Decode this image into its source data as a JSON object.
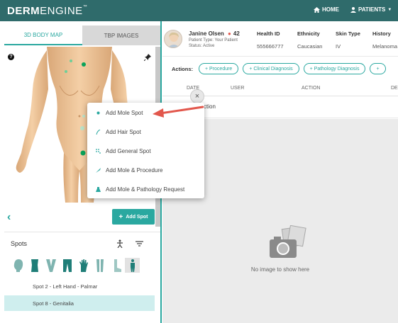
{
  "app": {
    "logo_bold": "DERM",
    "logo_light": "ENGINE",
    "logo_tm": "™",
    "nav_home": "HOME",
    "nav_patients": "PATIENTS"
  },
  "left": {
    "tabs": [
      {
        "label": "3D BODY MAP",
        "active": true
      },
      {
        "label": "TBP IMAGES",
        "active": false
      }
    ],
    "help_icon": "?",
    "add_spot_label": "Add Spot",
    "back_icon": "‹"
  },
  "spots": {
    "title": "Spots",
    "body_parts": [
      "head",
      "torso",
      "neck",
      "legs",
      "hand",
      "legs-back",
      "foot",
      "full-body"
    ],
    "items": [
      {
        "label": "Spot 2 - Left Hand - Palmar",
        "selected": false
      },
      {
        "label": "Spot 8 - Genitalia",
        "selected": true
      }
    ]
  },
  "patient": {
    "name": "Janine Olsen",
    "age": "42",
    "type": "Patient Type: Your Patient",
    "status": "Status: Active",
    "health_id_label": "Health ID",
    "health_id": "555666777",
    "ethnicity_label": "Ethnicity",
    "ethnicity": "Caucasian",
    "skin_type_label": "Skin Type",
    "skin_type": "IV",
    "history_label": "History",
    "history": "Melanoma"
  },
  "actions": {
    "label": "Actions:",
    "buttons": [
      "+ Procedure",
      "+ Clinical Diagnosis",
      "+ Pathology Diagnosis",
      "+"
    ]
  },
  "table": {
    "headers": [
      "DATE",
      "USER",
      "ACTION",
      "DE"
    ],
    "row_text": "ction"
  },
  "image_area": {
    "empty_text": "No image to show here"
  },
  "popup": {
    "items": [
      {
        "label": "Add Mole Spot",
        "icon": "dot-icon"
      },
      {
        "label": "Add Hair Spot",
        "icon": "hair-icon"
      },
      {
        "label": "Add General Spot",
        "icon": "dots-icon"
      },
      {
        "label": "Add Mole & Procedure",
        "icon": "scalpel-icon"
      },
      {
        "label": "Add Mole & Pathology Request",
        "icon": "flask-icon"
      }
    ]
  },
  "colors": {
    "header": "#2f6b6b",
    "accent": "#2aa8a0",
    "arrow": "#e2574c"
  }
}
